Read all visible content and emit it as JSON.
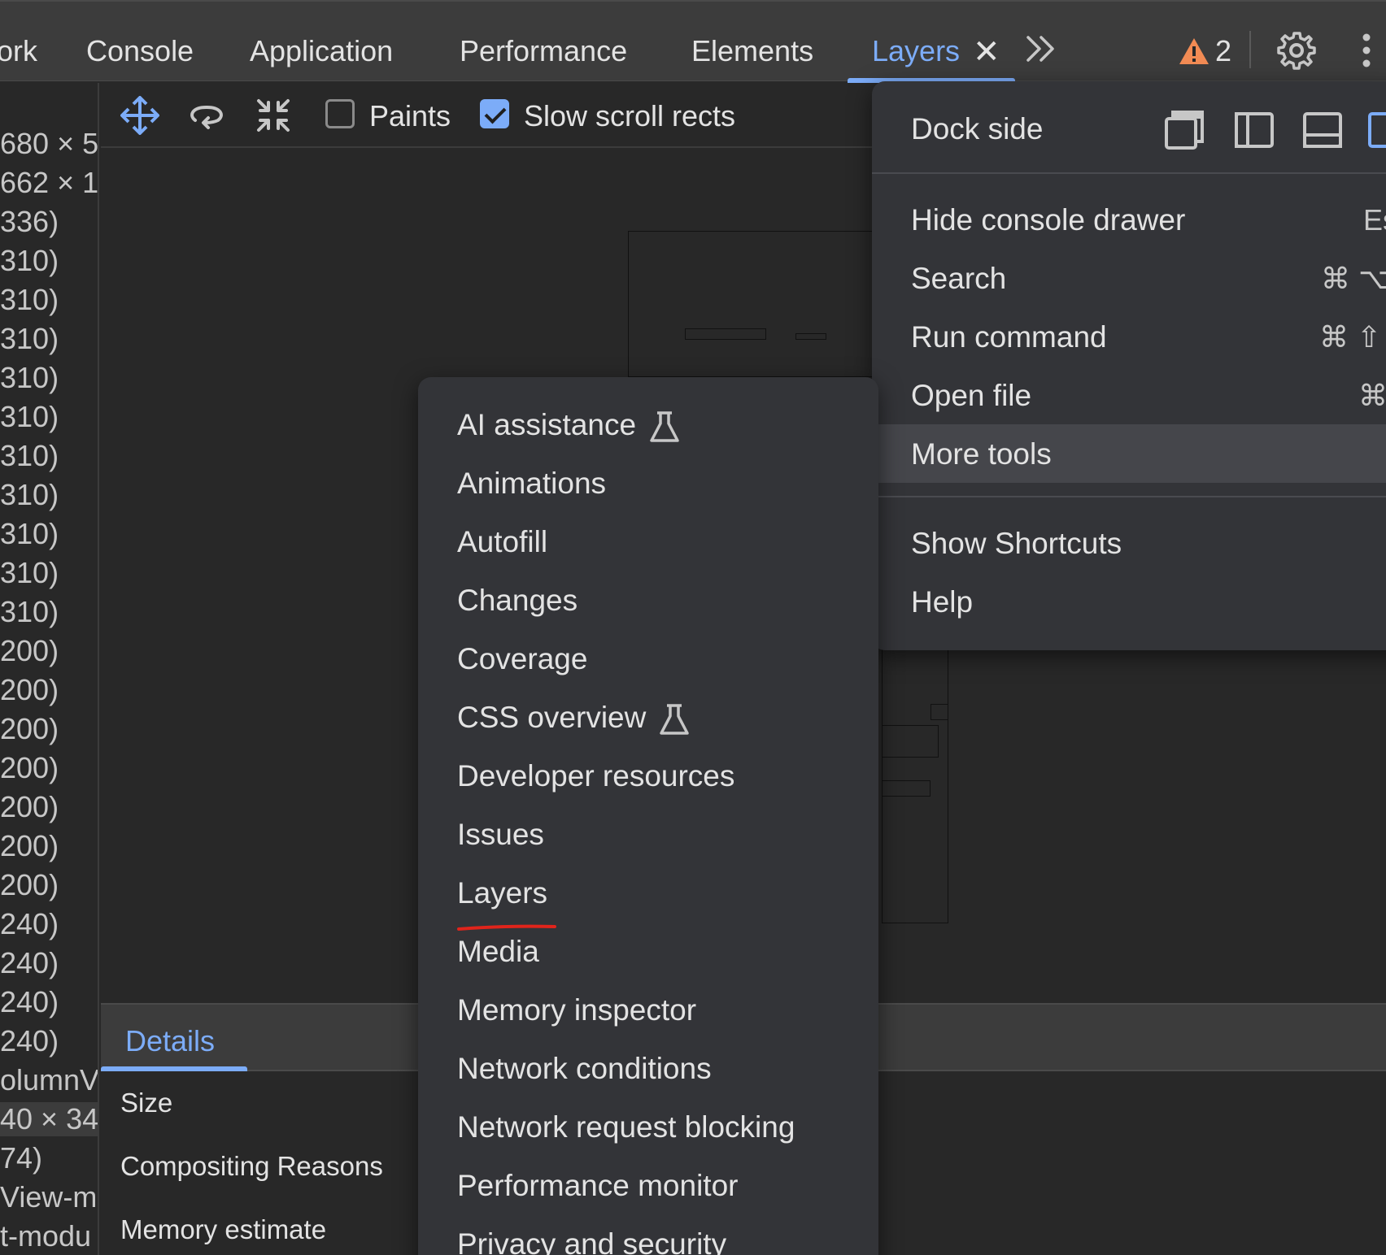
{
  "tabs": {
    "items": [
      {
        "label": "ork"
      },
      {
        "label": "Console"
      },
      {
        "label": "Application"
      },
      {
        "label": "Performance"
      },
      {
        "label": "Elements"
      },
      {
        "label": "Layers"
      }
    ],
    "more_label": "»",
    "warning_count": "2",
    "active_color": "#7cacf8",
    "warning_color": "#f28b54"
  },
  "left_list": [
    "680 × 5",
    "662 × 1",
    "336)",
    "310)",
    "310)",
    "310)",
    "310)",
    "310)",
    "310)",
    "310)",
    "310)",
    "310)",
    "310)",
    "200)",
    "200)",
    "200)",
    "200)",
    "200)",
    "200)",
    "200)",
    "240)",
    "240)",
    "240)",
    "240)",
    "olumnV",
    "40 × 34",
    " 74)",
    "View-mo",
    "t-modu"
  ],
  "toolbar": {
    "paints_label": "Paints",
    "paints_checked": false,
    "slow_scroll_label": "Slow scroll rects",
    "slow_scroll_checked": true
  },
  "details": {
    "tab_label": "Details",
    "props": [
      "Size",
      "Compositing Reasons",
      "Memory estimate"
    ]
  },
  "main_menu": {
    "dock_side_label": "Dock side",
    "items": [
      {
        "label": "Hide console drawer",
        "shortcut": "Es"
      },
      {
        "label": "Search",
        "shortcut": "⌘ ⌥"
      },
      {
        "label": "Run command",
        "shortcut": "⌘ ⇧"
      },
      {
        "label": "Open file",
        "shortcut": "⌘"
      },
      {
        "label": "More tools",
        "shortcut": ""
      }
    ],
    "items2": [
      {
        "label": "Show Shortcuts"
      },
      {
        "label": "Help"
      }
    ]
  },
  "more_tools_menu": {
    "items": [
      {
        "label": "AI assistance",
        "experimental": true
      },
      {
        "label": "Animations",
        "experimental": false
      },
      {
        "label": "Autofill",
        "experimental": false
      },
      {
        "label": "Changes",
        "experimental": false
      },
      {
        "label": "Coverage",
        "experimental": false
      },
      {
        "label": "CSS overview",
        "experimental": true
      },
      {
        "label": "Developer resources",
        "experimental": false
      },
      {
        "label": "Issues",
        "experimental": false
      },
      {
        "label": "Layers",
        "experimental": false
      },
      {
        "label": "Media",
        "experimental": false
      },
      {
        "label": "Memory inspector",
        "experimental": false
      },
      {
        "label": "Network conditions",
        "experimental": false
      },
      {
        "label": "Network request blocking",
        "experimental": false
      },
      {
        "label": "Performance monitor",
        "experimental": false
      },
      {
        "label": "Privacy and security",
        "experimental": false
      }
    ],
    "annotation_color": "#e0241b"
  }
}
